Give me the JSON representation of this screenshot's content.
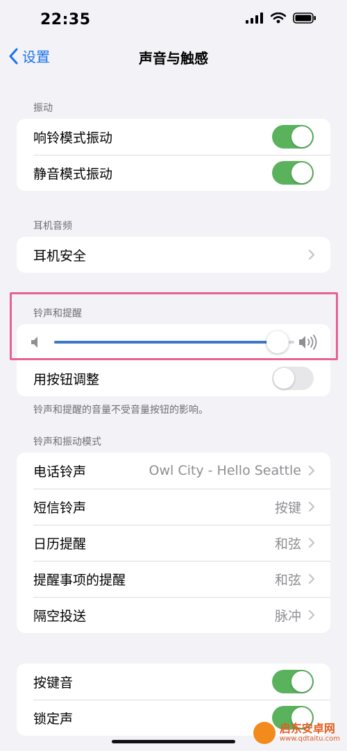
{
  "status": {
    "time": "22:35"
  },
  "nav": {
    "back_label": "设置",
    "title": "声音与触感"
  },
  "vibration": {
    "header": "振动",
    "items": [
      {
        "label": "响铃模式振动",
        "toggle": "on"
      },
      {
        "label": "静音模式振动",
        "toggle": "on"
      }
    ]
  },
  "headphone": {
    "header": "耳机音频",
    "items": [
      {
        "label": "耳机安全"
      }
    ]
  },
  "ringer": {
    "header": "铃声和提醒",
    "volume_level": 0.93,
    "adjust_label": "用按钮调整",
    "adjust_toggle": "off",
    "footnote": "铃声和提醒的音量不受音量按钮的影响。"
  },
  "patterns": {
    "header": "铃声和振动模式",
    "items": [
      {
        "label": "电话铃声",
        "value": "Owl City - Hello Seattle"
      },
      {
        "label": "短信铃声",
        "value": "按键"
      },
      {
        "label": "日历提醒",
        "value": "和弦"
      },
      {
        "label": "提醒事项的提醒",
        "value": "和弦"
      },
      {
        "label": "隔空投送",
        "value": "脉冲"
      }
    ]
  },
  "system_sounds": {
    "items": [
      {
        "label": "按键音",
        "toggle": "on"
      },
      {
        "label": "锁定声",
        "toggle": "on"
      }
    ]
  },
  "watermark": {
    "name": "启东安卓网",
    "url": "www.qdtaitu.com"
  },
  "colors": {
    "accent": "#1a73e8",
    "toggle_on": "#5ab25d",
    "slider_fill": "#3d78c6",
    "highlight": "#e8628e"
  }
}
